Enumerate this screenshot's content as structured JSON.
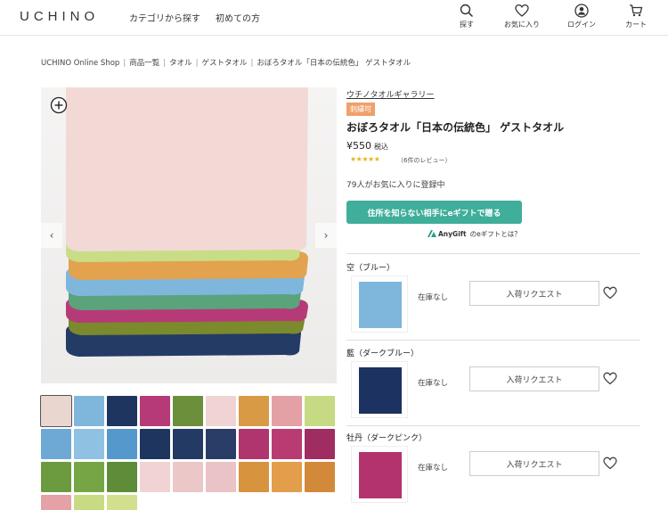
{
  "header": {
    "logo": "UCHINO",
    "nav": [
      "カテゴリから探す",
      "初めての方"
    ],
    "icons": [
      {
        "label": "探す",
        "icon": "search-icon"
      },
      {
        "label": "お気に入り",
        "icon": "heart-icon"
      },
      {
        "label": "ログイン",
        "icon": "user-icon"
      },
      {
        "label": "カート",
        "icon": "cart-icon"
      }
    ]
  },
  "breadcrumb": [
    "UCHINO Online Shop",
    "商品一覧",
    "タオル",
    "ゲストタオル",
    "おぼろタオル「日本の伝統色」 ゲストタオル"
  ],
  "product": {
    "gallery_link": "ウチノタオルギャラリー",
    "badge": "刺繍可",
    "title": "おぼろタオル「日本の伝統色」 ゲストタオル",
    "price": "¥550",
    "tax": "税込",
    "stars": "★★★★★",
    "review": "（6件のレビュー）",
    "favorites": "79人がお気に入りに登録中",
    "gift_button": "住所を知らない相手にeギフトで贈る",
    "anygift_logo": "AnyGift",
    "anygift_text": "のeギフトとは？"
  },
  "colors": {
    "accent": "#3fae9a",
    "badge": "#f0a06a",
    "star": "#e3b71f"
  },
  "towels": [
    "#f2d9d6",
    "#e8a1ad",
    "#c9dd86",
    "#e3a24e",
    "#7fb6dc",
    "#5aa37b",
    "#b73a78",
    "#7a8a2c",
    "#243b66"
  ],
  "thumbnails": [
    "#e8d6cf",
    "#7fb6dc",
    "#1e3560",
    "#b73a78",
    "#6b8f3a",
    "#f0d3d2",
    "#d99a45",
    "#e3a0a5",
    "#c6da84",
    "#6ea9d6",
    "#8fc1e3",
    "#5599cc",
    "#1e3560",
    "#233a65",
    "#2a3d66",
    "#b0356e",
    "#b83c72",
    "#a02d62",
    "#6b9a3f",
    "#76a546",
    "#5f8c38",
    "#f1d3d3",
    "#ecc7c8",
    "#e9c3c6",
    "#d8933f",
    "#e29e4a",
    "#d28939",
    "#e4a1a6",
    "#c8db83",
    "#d2e08e"
  ],
  "variants": [
    {
      "name": "空（ブルー）",
      "color": "#7fb6dc",
      "stock": "在庫なし",
      "button": "入荷リクエスト"
    },
    {
      "name": "藍（ダークブルー）",
      "color": "#1c3260",
      "stock": "在庫なし",
      "button": "入荷リクエスト"
    },
    {
      "name": "牡丹（ダークピンク）",
      "color": "#b3336e",
      "stock": "在庫なし",
      "button": "入荷リクエスト"
    }
  ]
}
